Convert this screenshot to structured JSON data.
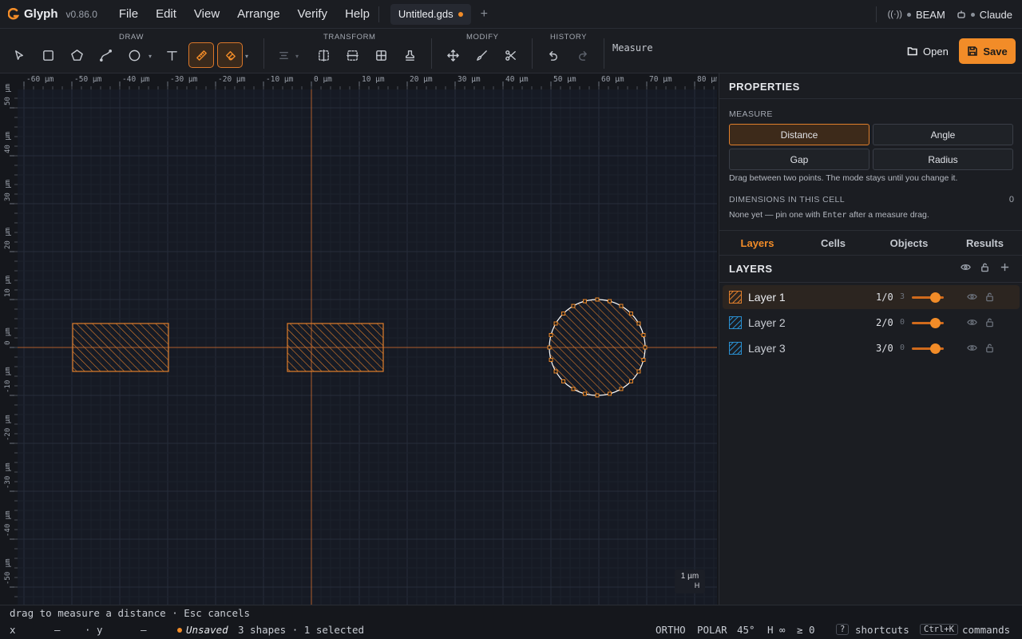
{
  "app": {
    "name": "Glyph",
    "version": "v0.86.0"
  },
  "menus": [
    "File",
    "Edit",
    "View",
    "Arrange",
    "Verify",
    "Help"
  ],
  "document_tab": {
    "name": "Untitled.gds"
  },
  "top_right": {
    "connection": "BEAM",
    "assistant": "Claude"
  },
  "toolbar": {
    "groups": {
      "draw": "DRAW",
      "transform": "TRANSFORM",
      "modify": "MODIFY",
      "history": "HISTORY"
    },
    "active_tool_label": "Measure",
    "open_label": "Open",
    "save_label": "Save"
  },
  "canvas": {
    "x_ticks": [
      "-60 µm",
      "-50 µm",
      "-40 µm",
      "-30 µm",
      "-20 µm",
      "-10 µm",
      "0 µm",
      "10 µm",
      "20 µm",
      "30 µm",
      "40 µm",
      "50 µm",
      "60 µm",
      "70 µm",
      "80 µm"
    ],
    "y_ticks": [
      "50 µm",
      "40 µm",
      "30 µm",
      "20 µm",
      "10 µm",
      "0 µm",
      "-10 µm",
      "-20 µm",
      "-30 µm",
      "-40 µm",
      "-50 µm"
    ],
    "scale_label": "1 µm",
    "scale_marker": "H",
    "accent": "#f28c28"
  },
  "panel": {
    "title": "PROPERTIES",
    "measure_label": "MEASURE",
    "modes": [
      "Distance",
      "Angle",
      "Gap",
      "Radius"
    ],
    "active_mode": "Distance",
    "mode_hint": "Drag between two points. The mode stays until you change it.",
    "dimensions_label": "DIMENSIONS IN THIS CELL",
    "dimensions_count": "0",
    "dimensions_hint_pre": "None yet — pin one with",
    "dimensions_hint_key": "Enter",
    "dimensions_hint_post": "after a measure drag."
  },
  "tabs": [
    "Layers",
    "Cells",
    "Objects",
    "Results"
  ],
  "active_tab": "Layers",
  "layers_title": "LAYERS",
  "layers": [
    {
      "name": "Layer 1",
      "gds": "1/0",
      "num": "3",
      "color": "#e07f2c",
      "selected": true
    },
    {
      "name": "Layer 2",
      "gds": "2/0",
      "num": "0",
      "color": "#2a8fd0",
      "selected": false
    },
    {
      "name": "Layer 3",
      "gds": "3/0",
      "num": "0",
      "color": "#2a8fd0",
      "selected": false
    }
  ],
  "hint_bar": "drag to measure a distance · Esc cancels",
  "status": {
    "x_label": "x",
    "x_value": "—",
    "y_label": "· y",
    "y_value": "—",
    "unsaved": "Unsaved",
    "counts": "3 shapes · 1 selected",
    "ortho": "ORTHO",
    "polar": "POLAR",
    "angle": "45°",
    "h_value": "H ∞",
    "ge_value": "≥ 0",
    "shortcuts_key": "?",
    "shortcuts_label": "shortcuts",
    "commands_key": "Ctrl+K",
    "commands_label": "commands"
  }
}
